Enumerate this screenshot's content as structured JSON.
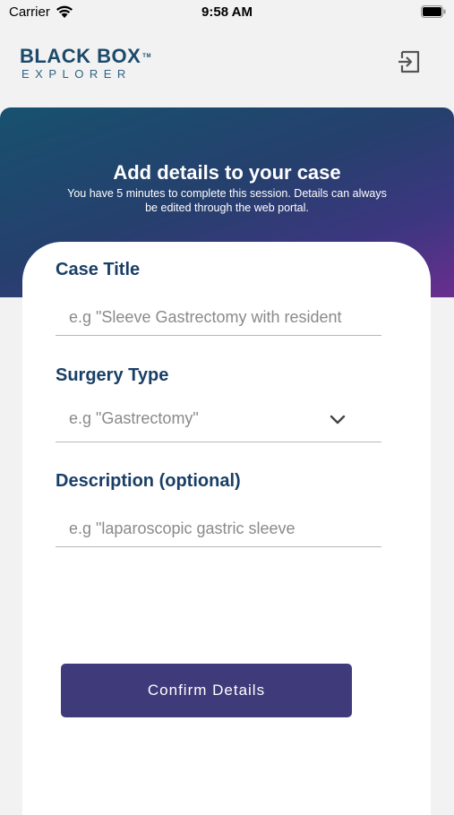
{
  "status_bar": {
    "carrier": "Carrier",
    "time": "9:58 AM",
    "icons": [
      "wifi-icon",
      "battery-icon"
    ]
  },
  "header": {
    "logo_main": "BLACK BOX",
    "logo_tm": "TM",
    "logo_sub": "EXPLORER",
    "exit_icon": "exit-icon"
  },
  "hero": {
    "title": "Add details to your case",
    "subtitle": "You have 5 minutes to complete this session. Details can always be edited through the web portal."
  },
  "form": {
    "case_title": {
      "label": "Case Title",
      "placeholder": "e.g \"Sleeve Gastrectomy with resident",
      "value": ""
    },
    "surgery_type": {
      "label": "Surgery Type",
      "placeholder": "e.g \"Gastrectomy\"",
      "icon": "chevron-down-icon"
    },
    "description": {
      "label": "Description (optional)",
      "placeholder": "e.g \"laparoscopic gastric sleeve",
      "value": ""
    },
    "confirm_label": "Confirm Details"
  },
  "colors": {
    "brand_dark": "#1a3f66",
    "button": "#3f3a7a",
    "gradient_start": "#17516f",
    "gradient_end": "#6a2e8e",
    "background": "#f2f2f2"
  }
}
